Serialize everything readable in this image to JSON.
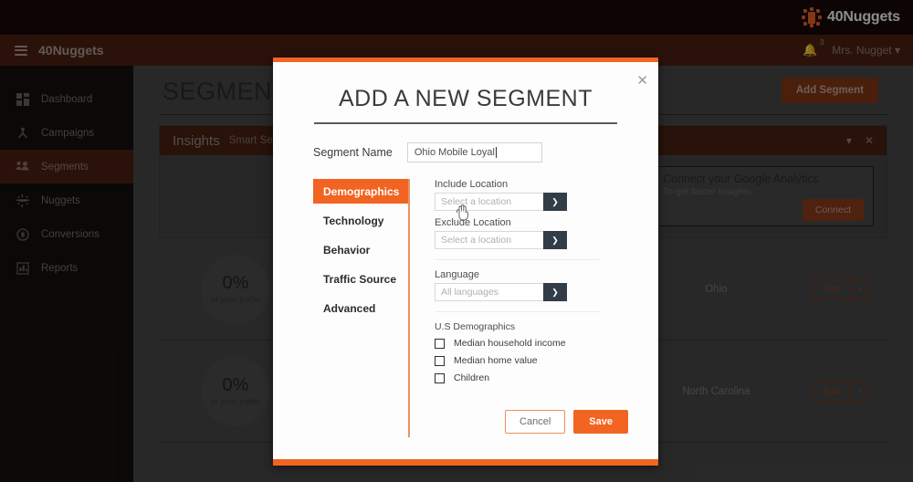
{
  "topbar": {
    "brand": "40Nuggets",
    "logo_icon": "sun-nugget-icon",
    "accent_color": "#f26422"
  },
  "navbar": {
    "menu_icon": "hamburger-icon",
    "brand": "40Nuggets",
    "bell_icon": "bell-icon",
    "notification_count": "3",
    "user_name": "Mrs. Nugget",
    "caret_icon": "chevron-down-icon"
  },
  "sidebar": {
    "items": [
      {
        "label": "Dashboard",
        "icon": "dashboard-grid-icon",
        "active": false
      },
      {
        "label": "Campaigns",
        "icon": "campaigns-node-icon",
        "active": false
      },
      {
        "label": "Segments",
        "icon": "segments-people-icon",
        "active": true
      },
      {
        "label": "Nuggets",
        "icon": "nuggets-icon",
        "active": false
      },
      {
        "label": "Conversions",
        "icon": "conversions-coin-icon",
        "active": false
      },
      {
        "label": "Reports",
        "icon": "reports-bars-icon",
        "active": false
      }
    ]
  },
  "main": {
    "page_title": "SEGMENTS",
    "add_segment_label": "Add Segment",
    "insights": {
      "title": "Insights",
      "subtitle": "Smart Segments",
      "collapse_icon": "chevron-down-icon",
      "close_icon": "close-icon"
    },
    "ga_card": {
      "lock_icon": "lock-icon",
      "title": "Connect your Google Analytics",
      "subtitle": "To get faster Insights",
      "connect_label": "Connect"
    },
    "segment_rows": [
      {
        "percent": "0%",
        "caption": "of your traffic",
        "state": "Ohio",
        "edit_label": "Edit",
        "caret_icon": "caret-down-icon"
      },
      {
        "percent": "0%",
        "caption": "of your traffic",
        "state": "North Carolina",
        "edit_label": "Edit",
        "caret_icon": "caret-down-icon"
      }
    ]
  },
  "modal": {
    "title": "ADD A NEW SEGMENT",
    "close_icon": "close-icon",
    "segment_name_label": "Segment Name",
    "segment_name_value": "Ohio Mobile Loyal",
    "tabs": [
      {
        "label": "Demographics",
        "active": true
      },
      {
        "label": "Technology",
        "active": false
      },
      {
        "label": "Behavior",
        "active": false
      },
      {
        "label": "Traffic Source",
        "active": false
      },
      {
        "label": "Advanced",
        "active": false
      }
    ],
    "fields": {
      "include_location_label": "Include Location",
      "include_location_placeholder": "Select a location",
      "exclude_location_label": "Exclude Location",
      "exclude_location_placeholder": "Select a location",
      "language_label": "Language",
      "language_placeholder": "All languages",
      "dropdown_icon": "chevron-down-icon"
    },
    "demographics": {
      "heading": "U.S Demographics",
      "checkboxes": [
        {
          "label": "Median household income",
          "checked": false
        },
        {
          "label": "Median home value",
          "checked": false
        },
        {
          "label": "Children",
          "checked": false
        }
      ]
    },
    "cancel_label": "Cancel",
    "save_label": "Save",
    "accent_color": "#f26422"
  }
}
